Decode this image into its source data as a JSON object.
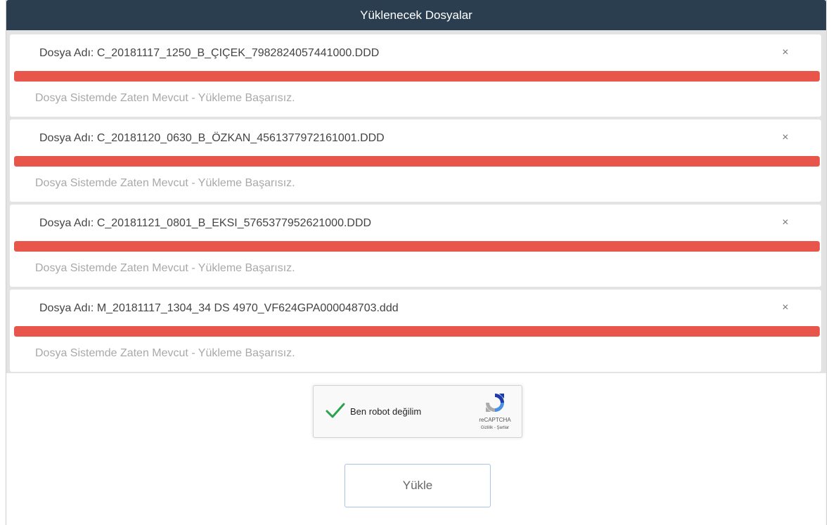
{
  "panel": {
    "title": "Yüklenecek Dosyalar"
  },
  "files": [
    {
      "name": "Dosya Adı: C_20181117_1250_B_ÇIÇEK_7982824057441000.DDD",
      "close": "×",
      "progress": 1.0,
      "status": "Dosya Sistemde Zaten Mevcut - Yükleme Başarısız."
    },
    {
      "name": "Dosya Adı: C_20181120_0630_B_ÖZKAN_4561377972161001.DDD",
      "close": "×",
      "progress": 1.0,
      "status": "Dosya Sistemde Zaten Mevcut - Yükleme Başarısız."
    },
    {
      "name": "Dosya Adı: C_20181121_0801_B_EKSI_5765377952621000.DDD",
      "close": "×",
      "progress": 1.0,
      "status": "Dosya Sistemde Zaten Mevcut - Yükleme Başarısız."
    },
    {
      "name": "Dosya Adı: M_20181117_1304_34 DS 4970_VF624GPA000048703.ddd",
      "close": "×",
      "progress": 1.0,
      "status": "Dosya Sistemde Zaten Mevcut - Yükleme Başarısız."
    }
  ],
  "captcha": {
    "label": "Ben robot değilim",
    "brand": "reCAPTCHA",
    "terms": "Gizlilik - Şartlar",
    "checked": true
  },
  "upload_button": {
    "label": "Yükle"
  },
  "colors": {
    "header_bg": "#2b3e50",
    "progress_error": "#e8554a",
    "check_green": "#2ba24c"
  }
}
